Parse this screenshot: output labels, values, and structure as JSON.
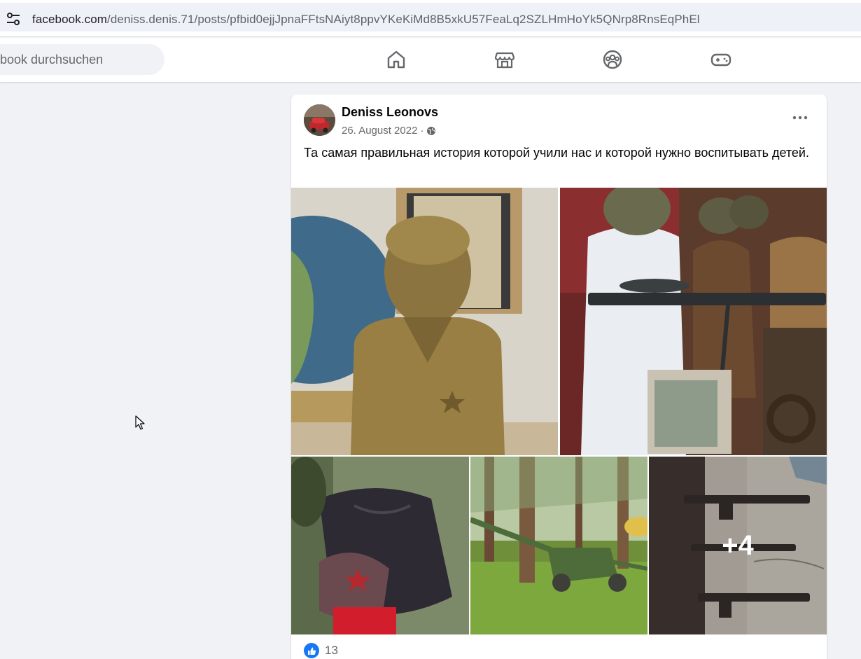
{
  "browser": {
    "url_host": "facebook.com",
    "url_path": "/deniss.denis.71/posts/pfbid0ejjJpnaFFtsNAiyt8ppvYKeKiMd8B5xkU57FeaLq2SZLHmHoYk5QNrp8RnsEqPhEl"
  },
  "nav": {
    "search_placeholder": "book durchsuchen",
    "icons": [
      "home-icon",
      "marketplace-icon",
      "groups-icon",
      "gaming-icon"
    ]
  },
  "post": {
    "author": "Deniss Leonovs",
    "date": "26. August 2022",
    "separator": "·",
    "audience_icon": "globe-icon",
    "text": "Та самая правильная история которой учили нас и которой нужно воспитывать детей.",
    "more_photos_label": "+4",
    "like_count": "13"
  },
  "colors": {
    "accent": "#1877f2",
    "page_bg": "#f0f2f5",
    "card_bg": "#ffffff",
    "secondary_text": "#65676b"
  }
}
